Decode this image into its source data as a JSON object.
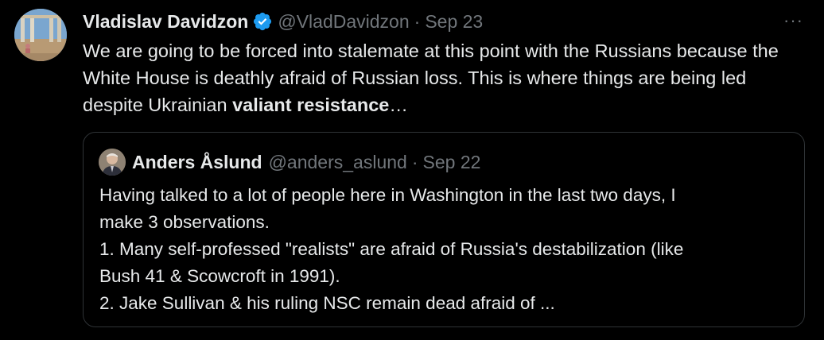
{
  "tweet": {
    "author_name": "Vladislav Davidzon",
    "handle": "@VladDavidzon",
    "separator": "·",
    "date": "Sep 23",
    "more_label": "···",
    "text_part1": "We are going to be forced into stalemate at this point with the Russians because the White House is deathly afraid of Russian loss. This is where things are being led despite Ukrainian ",
    "text_bold": "valiant resistance",
    "text_part2": "…"
  },
  "quoted": {
    "author_name": "Anders Åslund",
    "handle": "@anders_aslund",
    "separator": "·",
    "date": "Sep 22",
    "lines": [
      "Having talked to a lot of people here in Washington in the last two days, I",
      "make 3 observations.",
      "1. Many self-professed \"realists\" are afraid of Russia's destabilization (like",
      "Bush 41 & Scowcroft in 1991).",
      "2. Jake Sullivan & his ruling NSC remain dead afraid of ..."
    ]
  },
  "colors": {
    "background": "#000000",
    "text_primary": "#e7e9ea",
    "text_secondary": "#71767b",
    "verified_badge": "#1d9bf0",
    "quote_border": "#2f3336"
  },
  "icons": {
    "verified": "verified-badge-icon",
    "more": "more-options-icon"
  }
}
